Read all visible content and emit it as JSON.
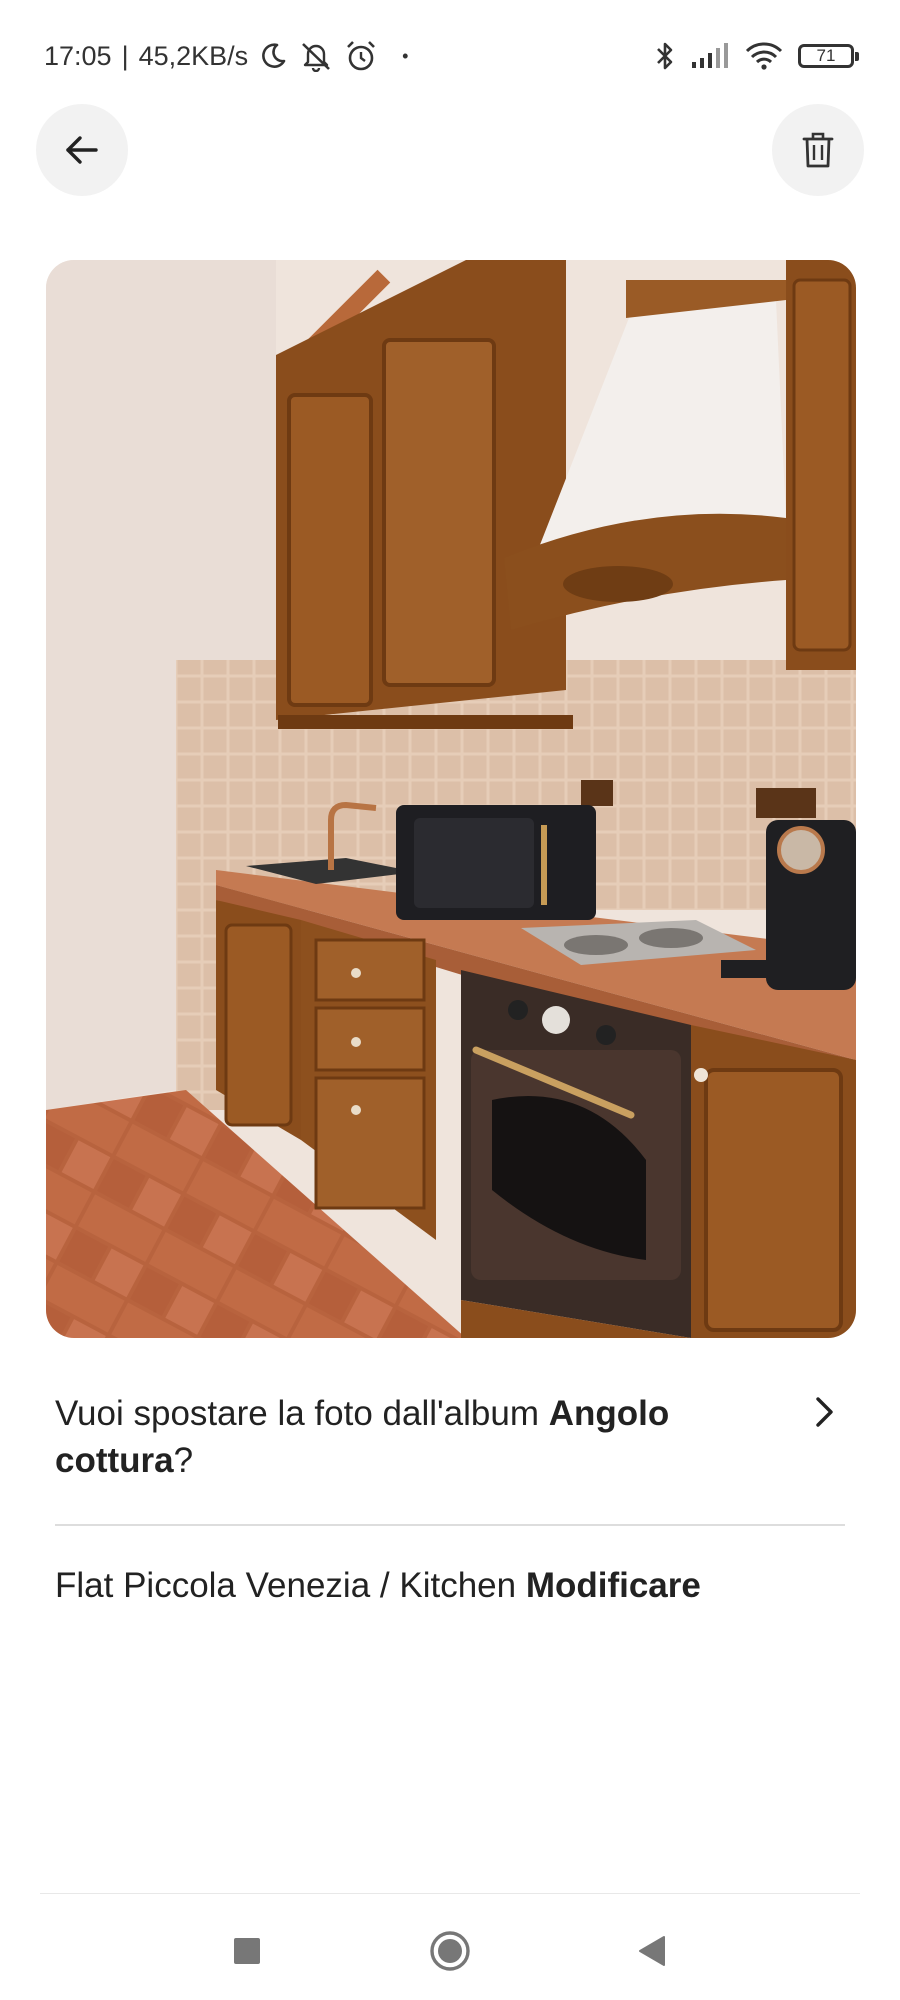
{
  "status_bar": {
    "time": "17:05",
    "separator": "|",
    "net_speed": "45,2KB/s",
    "dot": "•",
    "battery": "71",
    "icons": [
      "moon-icon",
      "notifications-off-icon",
      "alarm-icon",
      "bluetooth-icon",
      "signal-icon",
      "wifi-icon",
      "battery-icon"
    ]
  },
  "header": {
    "back_icon": "arrow-left-icon",
    "delete_icon": "trash-icon"
  },
  "photo": {
    "subject": "kitchen"
  },
  "move_prompt": {
    "prefix": "Vuoi spostare la foto dall'album ",
    "album_name": "Angolo cottura",
    "suffix": "?",
    "chevron_icon": "chevron-right-icon"
  },
  "album_path": {
    "path": "Flat Piccola Venezia / Kitchen ",
    "edit_label": "Modificare"
  },
  "nav_bar": {
    "icons": [
      "recent-apps-icon",
      "home-icon",
      "back-triangle-icon"
    ]
  },
  "colors": {
    "background": "#ffffff",
    "text": "#222222",
    "button_bg": "#f2f2f2",
    "divider": "#dddddd"
  }
}
